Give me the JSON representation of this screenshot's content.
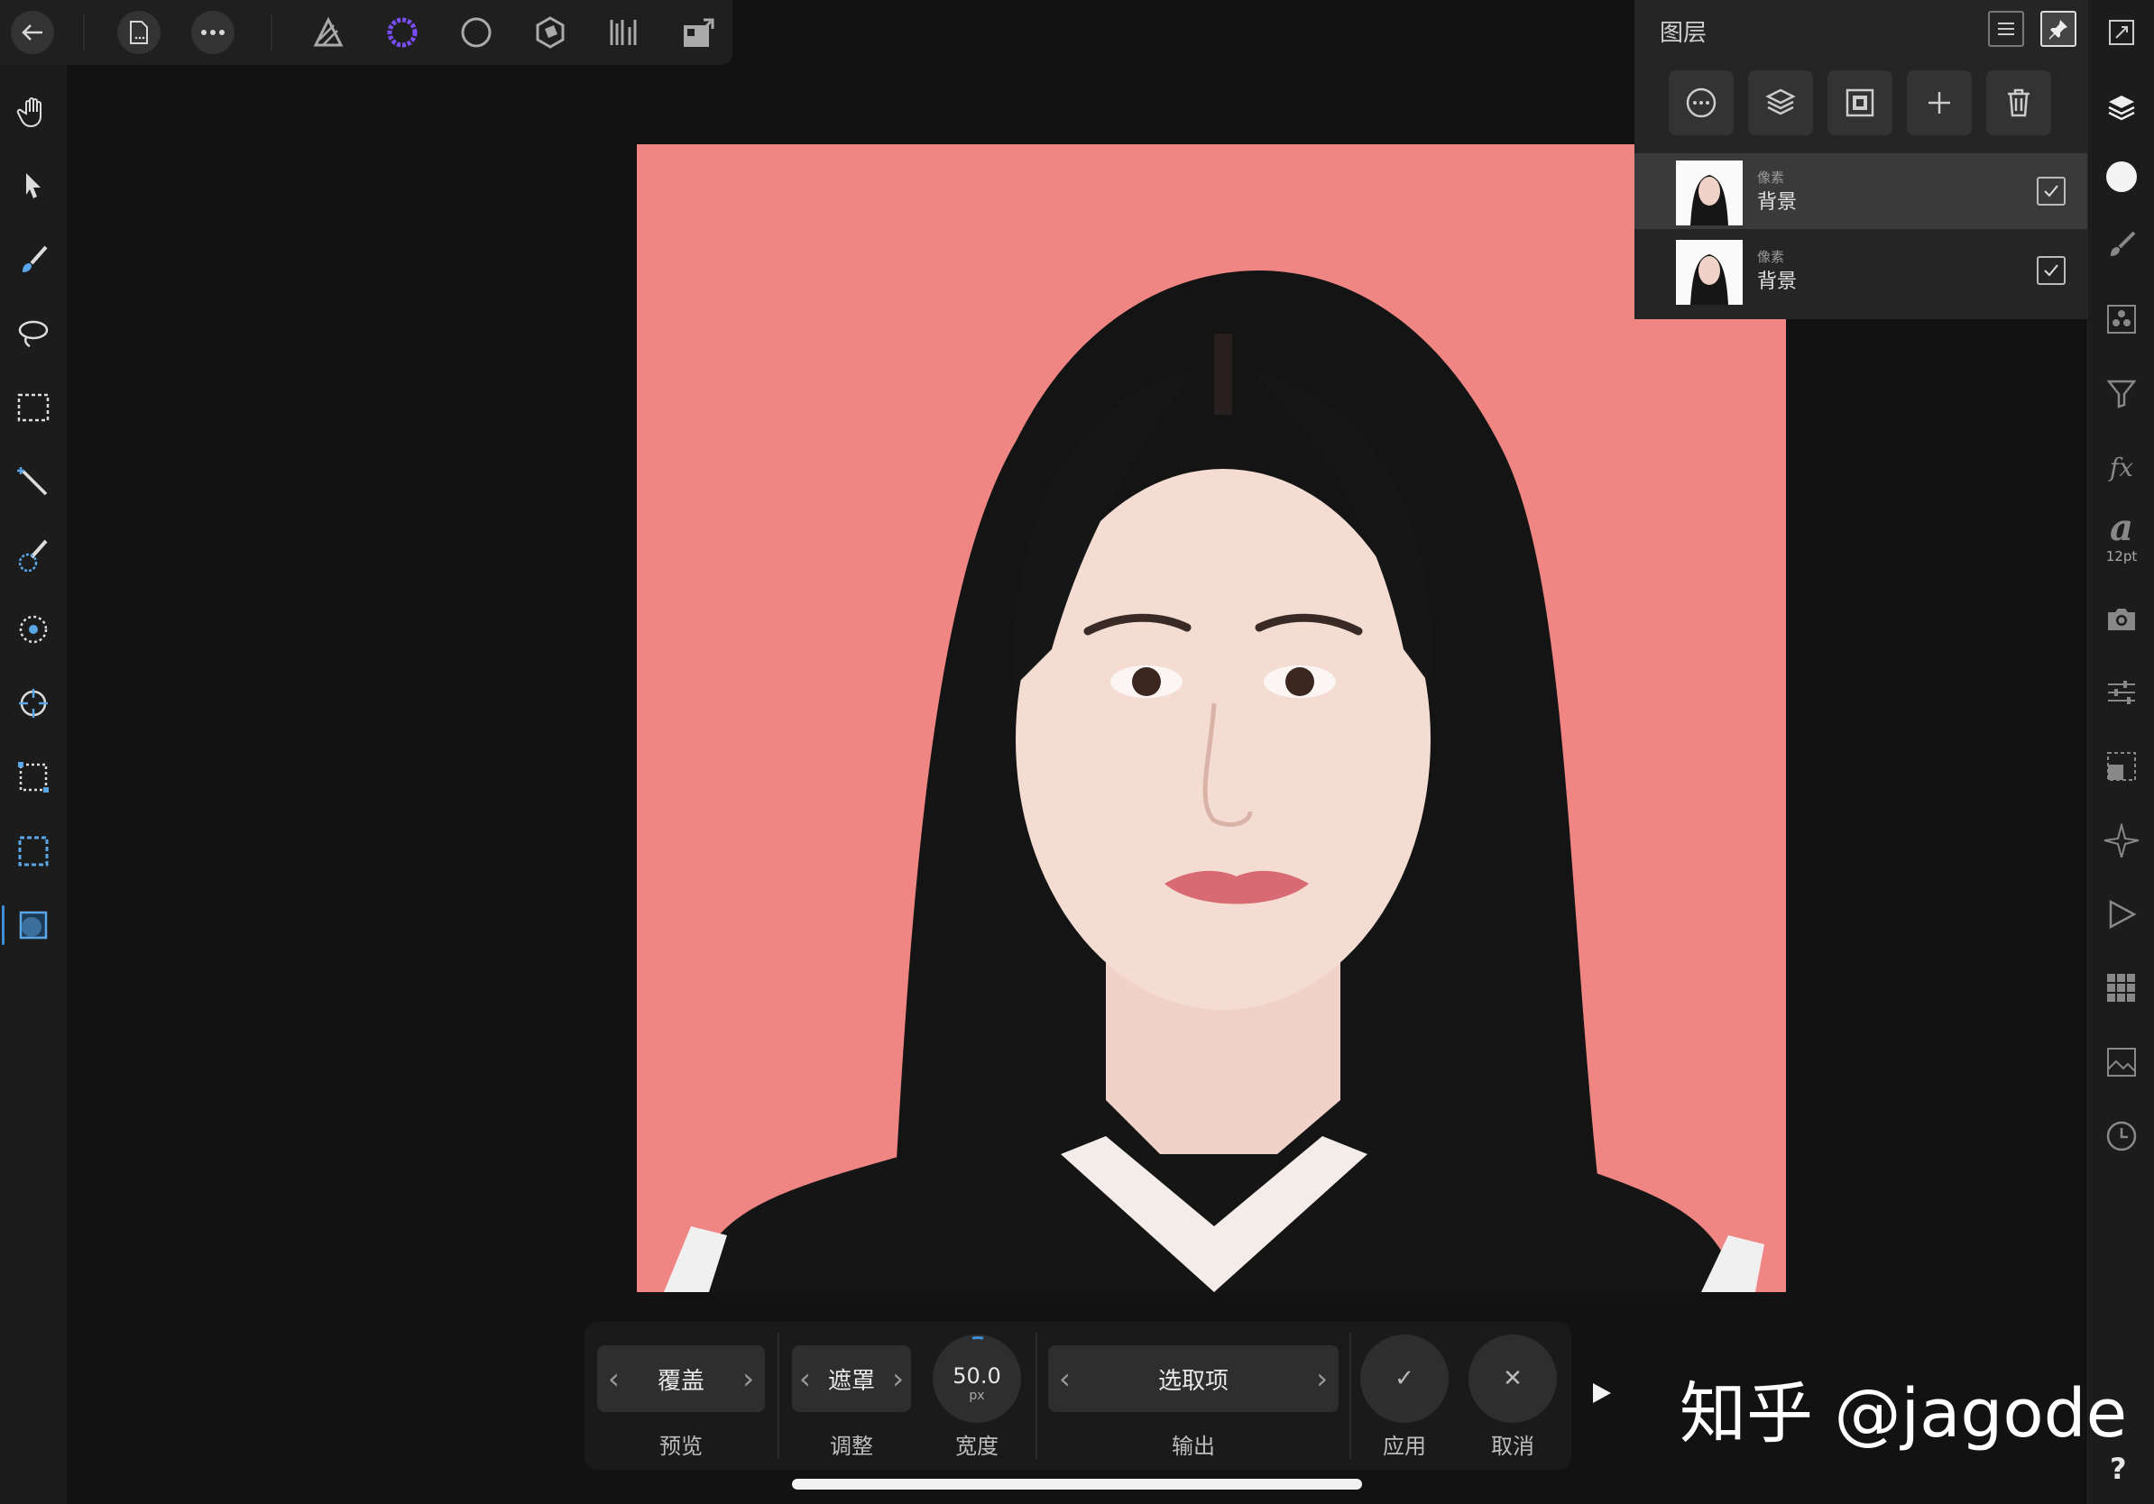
{
  "toolbar": {
    "icons": [
      "back-icon",
      "document-icon",
      "more-icon",
      "photo-persona-icon",
      "liquify-persona-icon",
      "develop-persona-icon",
      "tone-mapping-persona-icon",
      "export-persona-icon",
      "share-icon"
    ]
  },
  "tools": [
    "hand-tool",
    "move-tool",
    "paint-brush-tool",
    "lasso-tool",
    "marquee-tool",
    "flood-select-tool",
    "selection-brush-tool",
    "retouch-tool",
    "clone-tool",
    "crop-tool",
    "refine-selection-tool",
    "selection-refine-tool"
  ],
  "layers_panel": {
    "title": "图层",
    "layers": [
      {
        "type": "像素",
        "name": "背景",
        "visible": true,
        "selected": true
      },
      {
        "type": "像素",
        "name": "背景",
        "visible": true,
        "selected": false
      }
    ]
  },
  "studio": {
    "character_size": "12pt"
  },
  "context_toolbar": {
    "preview": {
      "value": "覆盖",
      "label": "预览"
    },
    "adjust": {
      "value": "遮罩",
      "label": "调整"
    },
    "width": {
      "value": "50.0",
      "unit": "px",
      "label": "宽度"
    },
    "output": {
      "value": "选取项",
      "label": "输出"
    },
    "apply": {
      "label": "应用"
    },
    "cancel": {
      "label": "取消"
    }
  },
  "watermark": "知乎 @jagode",
  "help": "?",
  "colors": {
    "background": "#121212",
    "panel": "#252525",
    "canvas_bg": "#ef8683",
    "accent": "#3d8fd8"
  }
}
